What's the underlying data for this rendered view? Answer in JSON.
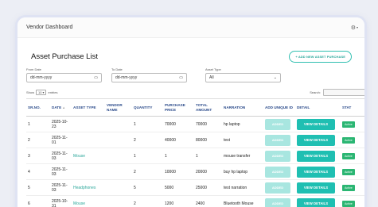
{
  "app": {
    "title": "Vendor Dashboard"
  },
  "icons": {
    "settings": "gear-icon",
    "dropdown": "chevron-down-icon",
    "calendar": "calendar-icon"
  },
  "colors": {
    "accent": "#1fbfb2",
    "header_text": "#2a4a8a",
    "status_active": "#2bb673",
    "added_disabled": "#a8e6e0"
  },
  "page": {
    "title": "Asset Purchase List",
    "add_button": "+ ADD NEW ASSET PURCHASE"
  },
  "filters": {
    "from_label": "From Date",
    "from_value": "dd-mm-yyyy",
    "to_label": "To Date",
    "to_value": "dd-mm-yyyy",
    "type_label": "Asset Type",
    "type_value": "All"
  },
  "table_controls": {
    "show_label": "Show",
    "entries_value": "10",
    "entries_label": "entries",
    "search_label": "Search:"
  },
  "table": {
    "headers": [
      "SR.NO.",
      "DATE",
      "ASSET TYPE",
      "VENDOR NAME",
      "QUANTITY",
      "PURCHASE PRICE",
      "TOTAL AMOUNT",
      "NARRATION",
      "ADD UNIQUE ID",
      "DETAIL",
      "STAT"
    ],
    "rows": [
      {
        "sr": "1",
        "date": "2025-10-23",
        "type": "",
        "vendor": "",
        "qty": "1",
        "price": "70000",
        "total": "70000",
        "narration": "hp laptop",
        "unique": "ADDED",
        "detail": "VIEW DETAILS",
        "status": "Active"
      },
      {
        "sr": "2",
        "date": "2025-11-01",
        "type": "",
        "vendor": "",
        "qty": "2",
        "price": "40000",
        "total": "80000",
        "narration": "test",
        "unique": "ADDED",
        "detail": "VIEW DETAILS",
        "status": "Active"
      },
      {
        "sr": "3",
        "date": "2025-11-03",
        "type": "Mouse",
        "vendor": "",
        "qty": "1",
        "price": "1",
        "total": "1",
        "narration": "mouse transfer",
        "unique": "ADDED",
        "detail": "VIEW DETAILS",
        "status": "Active"
      },
      {
        "sr": "4",
        "date": "2025-11-03",
        "type": "",
        "vendor": "",
        "qty": "2",
        "price": "10000",
        "total": "20000",
        "narration": "buy hp laptop",
        "unique": "ADDED",
        "detail": "VIEW DETAILS",
        "status": "Active"
      },
      {
        "sr": "5",
        "date": "2025-11-03",
        "type": "Headphones",
        "vendor": "",
        "qty": "5",
        "price": "5000",
        "total": "25000",
        "narration": "test narration",
        "unique": "ADDED",
        "detail": "VIEW DETAILS",
        "status": "Active"
      },
      {
        "sr": "6",
        "date": "2025-10-31",
        "type": "Mouse",
        "vendor": "",
        "qty": "2",
        "price": "1200",
        "total": "2400",
        "narration": "Bluetooth Mouse",
        "unique": "ADDED",
        "detail": "VIEW DETAILS",
        "status": "Active"
      }
    ]
  }
}
